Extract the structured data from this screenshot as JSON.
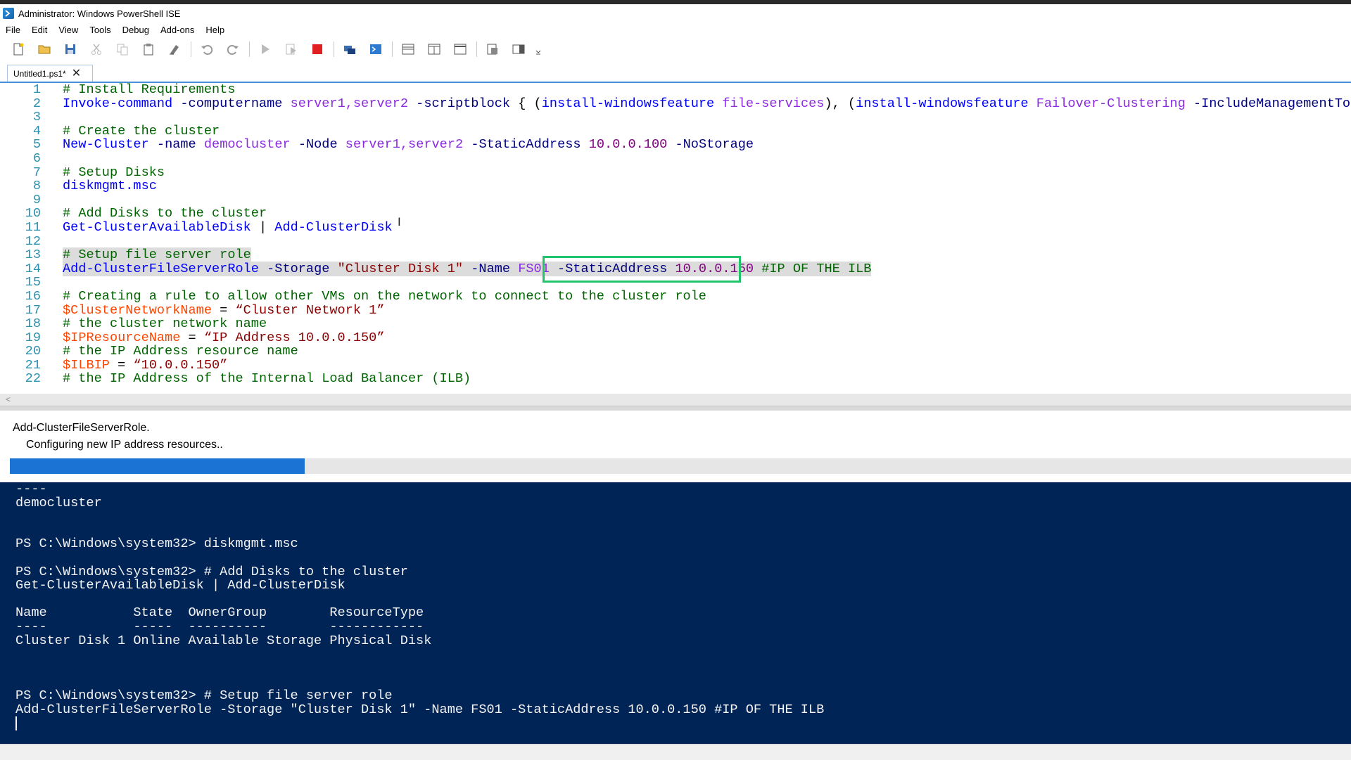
{
  "window": {
    "title": "Administrator: Windows PowerShell ISE"
  },
  "menu": [
    "File",
    "Edit",
    "View",
    "Tools",
    "Debug",
    "Add-ons",
    "Help"
  ],
  "toolbar": {
    "icons": [
      "new-icon",
      "open-icon",
      "save-icon",
      "cut-icon",
      "copy-icon",
      "paste-icon",
      "clear-icon",
      "undo-icon",
      "redo-icon",
      "run-icon",
      "run-selection-icon",
      "stop-icon",
      "remote-icon",
      "console-icon",
      "layout-top-icon",
      "layout-right-icon",
      "layout-max-icon",
      "addon-icon",
      "command-icon",
      "overflow-icon"
    ]
  },
  "tab": {
    "label": "Untitled1.ps1*",
    "close": "✕"
  },
  "editor": {
    "lines": [
      {
        "n": "1",
        "tokens": [
          [
            "c-comment",
            "# Install Requirements"
          ]
        ]
      },
      {
        "n": "2",
        "tokens": [
          [
            "c-cmd",
            "Invoke-command"
          ],
          [
            "c-plain",
            " "
          ],
          [
            "c-param",
            "-computername"
          ],
          [
            "c-plain",
            " "
          ],
          [
            "c-arg",
            "server1,server2"
          ],
          [
            "c-plain",
            " "
          ],
          [
            "c-param",
            "-scriptblock"
          ],
          [
            "c-plain",
            " { ("
          ],
          [
            "c-cmd",
            "install-windowsfeature"
          ],
          [
            "c-plain",
            " "
          ],
          [
            "c-arg",
            "file-services"
          ],
          [
            "c-plain",
            "), ("
          ],
          [
            "c-cmd",
            "install-windowsfeature"
          ],
          [
            "c-plain",
            " "
          ],
          [
            "c-arg",
            "Failover-Clustering"
          ],
          [
            "c-plain",
            " "
          ],
          [
            "c-param",
            "-IncludeManagementTools"
          ],
          [
            "c-plain",
            ")"
          ]
        ]
      },
      {
        "n": "3",
        "tokens": []
      },
      {
        "n": "4",
        "tokens": [
          [
            "c-comment",
            "# Create the cluster"
          ]
        ]
      },
      {
        "n": "5",
        "tokens": [
          [
            "c-cmd",
            "New-Cluster"
          ],
          [
            "c-plain",
            " "
          ],
          [
            "c-param",
            "-name"
          ],
          [
            "c-plain",
            " "
          ],
          [
            "c-arg",
            "democluster"
          ],
          [
            "c-plain",
            " "
          ],
          [
            "c-param",
            "-Node"
          ],
          [
            "c-plain",
            " "
          ],
          [
            "c-arg",
            "server1,server2"
          ],
          [
            "c-plain",
            " "
          ],
          [
            "c-param",
            "-StaticAddress"
          ],
          [
            "c-plain",
            " "
          ],
          [
            "c-num",
            "10.0.0.100"
          ],
          [
            "c-plain",
            " "
          ],
          [
            "c-param",
            "-NoStorage"
          ]
        ]
      },
      {
        "n": "6",
        "tokens": []
      },
      {
        "n": "7",
        "tokens": [
          [
            "c-comment",
            "# Setup Disks"
          ]
        ]
      },
      {
        "n": "8",
        "tokens": [
          [
            "c-cmd",
            "diskmgmt.msc"
          ]
        ]
      },
      {
        "n": "9",
        "tokens": []
      },
      {
        "n": "10",
        "tokens": [
          [
            "c-comment",
            "# Add Disks to the cluster"
          ]
        ]
      },
      {
        "n": "11",
        "tokens": [
          [
            "c-cmd",
            "Get-ClusterAvailableDisk"
          ],
          [
            "c-plain",
            " | "
          ],
          [
            "c-cmd",
            "Add-ClusterDisk"
          ]
        ]
      },
      {
        "n": "12",
        "tokens": []
      },
      {
        "n": "13",
        "sel": true,
        "tokens": [
          [
            "c-comment",
            "# Setup file server role"
          ]
        ]
      },
      {
        "n": "14",
        "sel": true,
        "tokens": [
          [
            "c-cmd",
            "Add-ClusterFileServerRole"
          ],
          [
            "c-plain",
            " "
          ],
          [
            "c-param",
            "-Storage"
          ],
          [
            "c-plain",
            " "
          ],
          [
            "c-str",
            "\"Cluster Disk 1\""
          ],
          [
            "c-plain",
            " "
          ],
          [
            "c-param",
            "-Name"
          ],
          [
            "c-plain",
            " "
          ],
          [
            "c-arg",
            "FS01"
          ],
          [
            "c-plain",
            " "
          ],
          [
            "c-param",
            "-StaticAddress"
          ],
          [
            "c-plain",
            " "
          ],
          [
            "c-num",
            "10.0.0.150"
          ],
          [
            "c-plain",
            " "
          ],
          [
            "c-comment",
            "#IP OF THE ILB"
          ]
        ]
      },
      {
        "n": "15",
        "tokens": []
      },
      {
        "n": "16",
        "tokens": [
          [
            "c-comment",
            "# Creating a rule to allow other VMs on the network to connect to the cluster role"
          ]
        ]
      },
      {
        "n": "17",
        "tokens": [
          [
            "c-var",
            "$ClusterNetworkName"
          ],
          [
            "c-plain",
            " = "
          ],
          [
            "c-str",
            "“Cluster Network 1”"
          ]
        ]
      },
      {
        "n": "18",
        "tokens": [
          [
            "c-comment",
            "# the cluster network name"
          ]
        ]
      },
      {
        "n": "19",
        "tokens": [
          [
            "c-var",
            "$IPResourceName"
          ],
          [
            "c-plain",
            " = "
          ],
          [
            "c-str",
            "“IP Address 10.0.0.150”"
          ]
        ]
      },
      {
        "n": "20",
        "tokens": [
          [
            "c-comment",
            "# the IP Address resource name"
          ]
        ]
      },
      {
        "n": "21",
        "tokens": [
          [
            "c-var",
            "$ILBIP"
          ],
          [
            "c-plain",
            " = "
          ],
          [
            "c-str",
            "“10.0.0.150”"
          ]
        ]
      },
      {
        "n": "22",
        "tokens": [
          [
            "c-comment",
            "# the IP Address of the Internal Load Balancer (ILB)"
          ]
        ]
      }
    ]
  },
  "progress": {
    "title": "Add-ClusterFileServerRole.",
    "status": "Configuring new IP address resources..",
    "fraction": 0.22
  },
  "console": {
    "lines": [
      "----",
      "democluster",
      "",
      "",
      "PS C:\\Windows\\system32> diskmgmt.msc",
      "",
      "PS C:\\Windows\\system32> # Add Disks to the cluster",
      "Get-ClusterAvailableDisk | Add-ClusterDisk",
      "",
      "Name           State  OwnerGroup        ResourceType",
      "----           -----  ----------        ------------",
      "Cluster Disk 1 Online Available Storage Physical Disk",
      "",
      "",
      "",
      "PS C:\\Windows\\system32> # Setup file server role",
      "Add-ClusterFileServerRole -Storage \"Cluster Disk 1\" -Name FS01 -StaticAddress 10.0.0.150 #IP OF THE ILB"
    ]
  },
  "colors": {
    "console_bg": "#012456",
    "progress_fill": "#1b74d3",
    "highlight_box": "#21c46b"
  }
}
